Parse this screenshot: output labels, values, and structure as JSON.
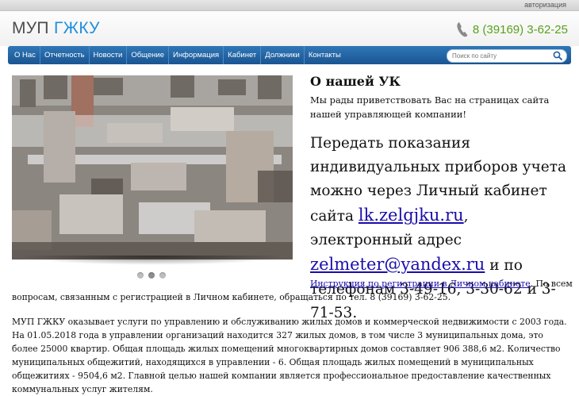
{
  "topbar": {
    "auth_link": "авторизация"
  },
  "header": {
    "logo_part1": "МУП ",
    "logo_part2": "ГЖКУ",
    "phone_icon": "phone-icon",
    "phone": "8 (39169) 3-62-25"
  },
  "nav": {
    "items": [
      "О Нас",
      "Отчетность",
      "Новости",
      "Общение",
      "Информация",
      "Кабинет",
      "Должники",
      "Контакты"
    ]
  },
  "search": {
    "placeholder": "Поиск по сайту",
    "icon": "search-icon"
  },
  "slider": {
    "dots": 3,
    "active_index": 1
  },
  "content": {
    "title": "О нашей УК",
    "welcome": "Мы рады приветствовать Вас на страницах сайта нашей управляющей компании!",
    "meters_text1": "Передать показания индивидуальных приборов учета можно через Личный кабинет сайта ",
    "meters_link1": "lk.zelgjku.ru",
    "meters_text2": ", электронный адрес ",
    "meters_link2": "zelmeter@yandex.ru",
    "meters_text3": " и по телефонам 3-49-16, 3-30-62 и 3-71-53.",
    "instr_link": "Инструкция по регистрации в Личном кабинете",
    "instr_text1": ". По всем",
    "instr_text2": "вопросам, связанным с регистрацией в Личном кабинете, обращаться по тел.  8 (39169) 3-62-25.",
    "description": "МУП ГЖКУ оказывает услуги по управлению и обслуживанию жилых домов и коммерческой недвижимости с 2003 года. На 01.05.2018 года в управлении организаций находится 327 жилых домов, в том числе 3 муниципальных дома, это более 25000 квартир. Общая площадь жилых помещений многоквартирных домов составляет 906 388,6 м2. Количество муниципальных общежитий, находящихся в управлении - 6. Общая площадь жилых помещений в муниципальных общежитиях - 9504,6 м2. Главной целью нашей компании является профессиональное предоставление качественных коммунальных услуг жителям."
  },
  "colors": {
    "accent": "#1e8fdb",
    "nav": "#1f5f9f",
    "phone": "#58a21b",
    "link": "#1a0dab"
  }
}
